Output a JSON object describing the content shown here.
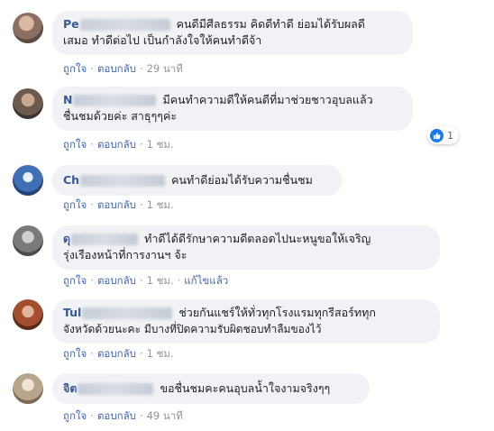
{
  "colors": {
    "bubble_bg": "#f0f2f5",
    "author": "#385898",
    "action_link": "#4267b2",
    "meta": "#90949c",
    "like_blue": "#1877f2"
  },
  "comments": [
    {
      "author": "Pe",
      "text_line1": "คนดีมีศีลธรรม คิดดีทำดี ย่อมได้รับผลดี",
      "text_line2": "เสมอ ทำดีต่อไป เป็นกำลังใจให้คนทำดีจ้า",
      "like": "ถูกใจ",
      "reply": "ตอบกลับ",
      "time": "29 นาที",
      "avatar_color": "#8d6e63"
    },
    {
      "author": "N",
      "text_line1": "มีคนทำความดีให้คนดีที่มาช่วยชาวอุบลแล้ว",
      "text_line2": "ชื่นชมด้วยค่ะ สาธุๆๆค่ะ",
      "like": "ถูกใจ",
      "reply": "ตอบกลับ",
      "time": "1 ชม.",
      "reaction_icon": "like-icon",
      "reaction_count": "1",
      "avatar_color": "#6d5a4f"
    },
    {
      "author": "Ch",
      "text_line1": "คนทำดีย่อมได้รับความชื่นชม",
      "like": "ถูกใจ",
      "reply": "ตอบกลับ",
      "time": "1 ชม.",
      "avatar_color": "#3f6fb5"
    },
    {
      "author": "ดุ",
      "text_line1": "ทำดีได้ดีรักษาความดีตลอดไปนะหนูขอให้เจริญ",
      "text_line2": "รุ่งเรืองหน้าที่การงานฯ จ้ะ",
      "like": "ถูกใจ",
      "reply": "ตอบกลับ",
      "time": "1 ชม.",
      "edited": "แก้ไขแล้ว",
      "avatar_color": "#7a7a7a"
    },
    {
      "author": "Tul",
      "text_line1": "ช่วยกันแชร์ให้ทั่วทุกโรงแรมทุกรีสอร์ททุก",
      "text_line2": "จังหวัดด้วยนะคะ มีบางที่ปิดความรับผิดชอบทำลืมของไว้",
      "like": "ถูกใจ",
      "reply": "ตอบกลับ",
      "time": "1 ชม.",
      "avatar_color": "#a34f2e"
    },
    {
      "author": "จิต",
      "text_line1": "ขอชื่นชมคะคนอุบลน้ำใจงามจริงๆๆ",
      "like": "ถูกใจ",
      "reply": "ตอบกลับ",
      "time": "49 นาที",
      "avatar_color": "#b8a58e"
    }
  ]
}
